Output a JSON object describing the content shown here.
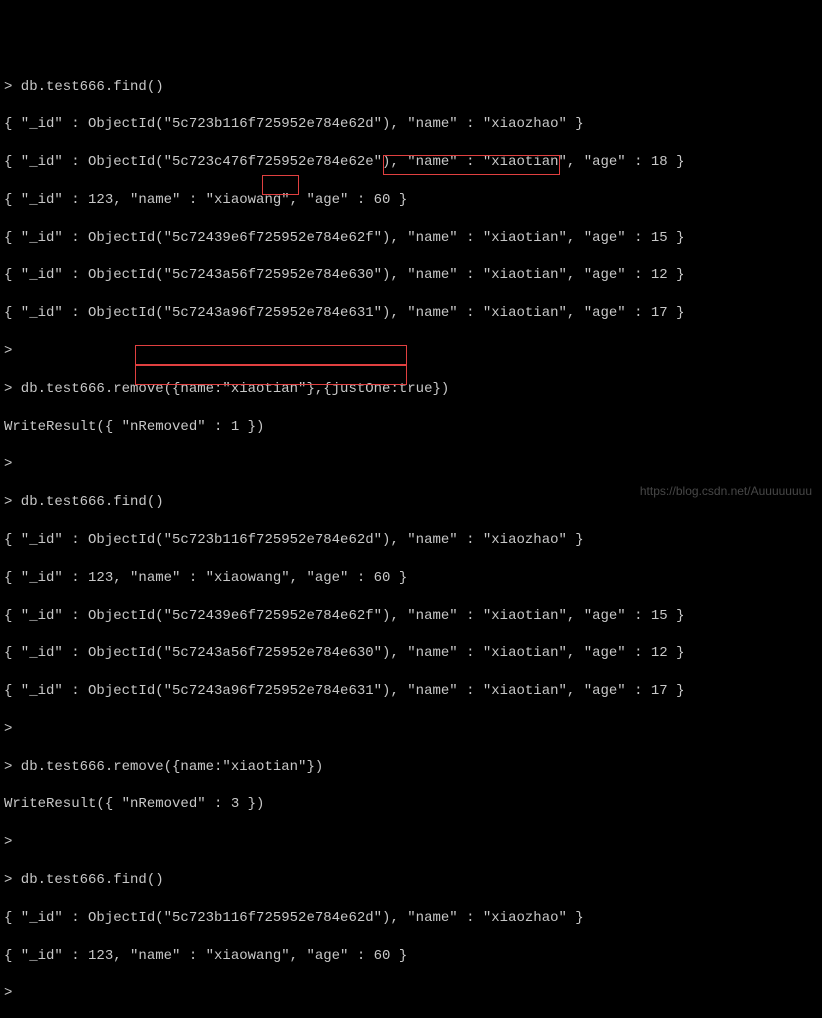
{
  "lines": {
    "l1": "> db.test666.find()",
    "l2": "{ \"_id\" : ObjectId(\"5c723b116f725952e784e62d\"), \"name\" : \"xiaozhao\" }",
    "l3": "{ \"_id\" : ObjectId(\"5c723c476f725952e784e62e\"), \"name\" : \"xiaotian\", \"age\" : 18 }",
    "l4": "{ \"_id\" : 123, \"name\" : \"xiaowang\", \"age\" : 60 }",
    "l5": "{ \"_id\" : ObjectId(\"5c72439e6f725952e784e62f\"), \"name\" : \"xiaotian\", \"age\" : 15 }",
    "l6": "{ \"_id\" : ObjectId(\"5c7243a56f725952e784e630\"), \"name\" : \"xiaotian\", \"age\" : 12 }",
    "l7": "{ \"_id\" : ObjectId(\"5c7243a96f725952e784e631\"), \"name\" : \"xiaotian\", \"age\" : 17 }",
    "l8": ">",
    "l9": "> db.test666.remove({name:\"xiaotian\"},{justOne:true})",
    "l10": "WriteResult({ \"nRemoved\" : 1 })",
    "l11": ">",
    "l12": "> db.test666.find()",
    "l13": "{ \"_id\" : ObjectId(\"5c723b116f725952e784e62d\"), \"name\" : \"xiaozhao\" }",
    "l14": "{ \"_id\" : 123, \"name\" : \"xiaowang\", \"age\" : 60 }",
    "l15": "{ \"_id\" : ObjectId(\"5c72439e6f725952e784e62f\"), \"name\" : \"xiaotian\", \"age\" : 15 }",
    "l16": "{ \"_id\" : ObjectId(\"5c7243a56f725952e784e630\"), \"name\" : \"xiaotian\", \"age\" : 12 }",
    "l17": "{ \"_id\" : ObjectId(\"5c7243a96f725952e784e631\"), \"name\" : \"xiaotian\", \"age\" : 17 }",
    "l18": ">",
    "l19": "> db.test666.remove({name:\"xiaotian\"})",
    "l20": "WriteResult({ \"nRemoved\" : 3 })",
    "l21": ">",
    "l22": "> db.test666.find()",
    "l23": "{ \"_id\" : ObjectId(\"5c723b116f725952e784e62d\"), \"name\" : \"xiaozhao\" }",
    "l24": "{ \"_id\" : 123, \"name\" : \"xiaowang\", \"age\" : 60 }",
    "l25": ">"
  },
  "watermark": "https://blog.csdn.net/Auuuuuuuu"
}
